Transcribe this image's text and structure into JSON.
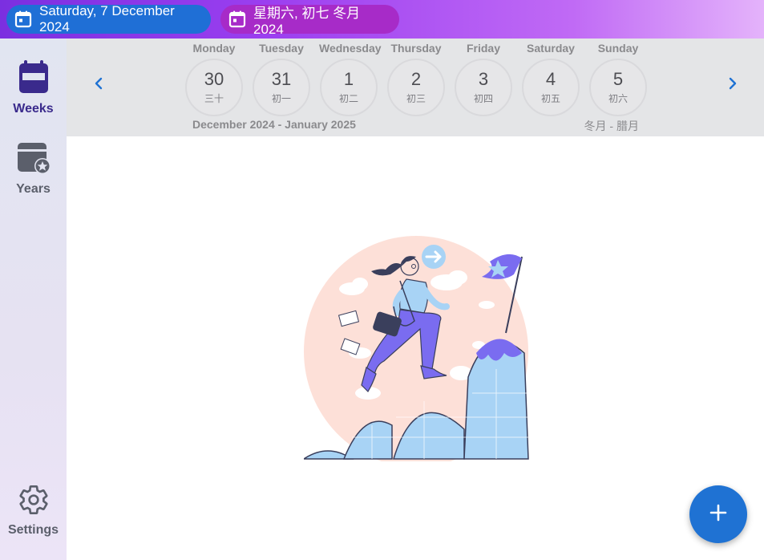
{
  "header": {
    "gregorian_date": "Saturday, 7 December 2024",
    "lunar_date": "星期六, 初七 冬月 2024"
  },
  "sidebar": {
    "items": [
      {
        "label": "Weeks",
        "icon": "calendar-week-icon",
        "active": true
      },
      {
        "label": "Years",
        "icon": "calendar-star-icon",
        "active": false
      },
      {
        "label": "Settings",
        "icon": "gear-icon",
        "active": false
      }
    ]
  },
  "week": {
    "days": [
      {
        "name": "Monday",
        "num": "30",
        "lunar": "三十"
      },
      {
        "name": "Tuesday",
        "num": "31",
        "lunar": "初一"
      },
      {
        "name": "Wednesday",
        "num": "1",
        "lunar": "初二"
      },
      {
        "name": "Thursday",
        "num": "2",
        "lunar": "初三"
      },
      {
        "name": "Friday",
        "num": "3",
        "lunar": "初四"
      },
      {
        "name": "Saturday",
        "num": "4",
        "lunar": "初五"
      },
      {
        "name": "Sunday",
        "num": "5",
        "lunar": "初六"
      }
    ],
    "range_gregorian": "December 2024 - January 2025",
    "range_lunar": "冬月 - 腊月"
  },
  "colors": {
    "accent_blue": "#1f72d3",
    "lunar_pill": "#a72bc8",
    "active_nav": "#3a2a8c"
  },
  "fab": {
    "icon": "plus-icon"
  }
}
